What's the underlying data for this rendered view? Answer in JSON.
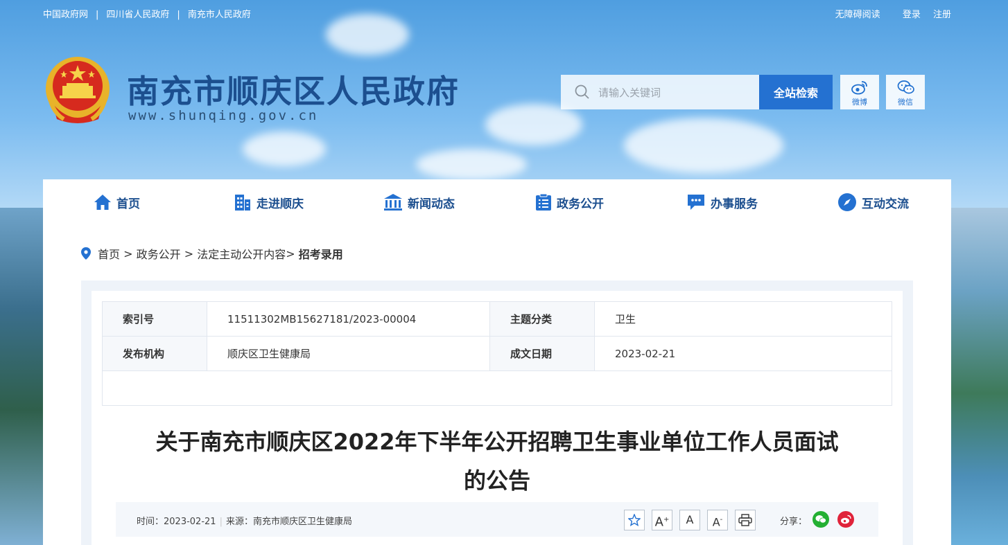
{
  "topbar": {
    "links": [
      "中国政府网",
      "四川省人民政府",
      "南充市人民政府"
    ],
    "separator": "|",
    "accessibility": "无障碍阅读",
    "login": "登录",
    "register": "注册"
  },
  "header": {
    "title": "南充市顺庆区人民政府",
    "url": "www.shunqing.gov.cn",
    "search_placeholder": "请输入关键词",
    "search_button": "全站检索",
    "weibo_label": "微博",
    "wechat_label": "微信"
  },
  "nav": {
    "items": [
      "首页",
      "走进顺庆",
      "新闻动态",
      "政务公开",
      "办事服务",
      "互动交流"
    ]
  },
  "breadcrumb": {
    "items": [
      "首页",
      "政务公开",
      "法定主动公开内容"
    ],
    "separator": " > ",
    "current_prefix": "> ",
    "current": "招考录用"
  },
  "meta": {
    "index_label": "索引号",
    "index_value": "11511302MB15627181/2023-00004",
    "topic_label": "主题分类",
    "topic_value": "卫生",
    "publisher_label": "发布机构",
    "publisher_value": "顺庆区卫生健康局",
    "date_label": "成文日期",
    "date_value": "2023-02-21"
  },
  "article": {
    "title_line1": "关于南充市顺庆区2022年下半年公开招聘卫生事业单位工作人员面试",
    "title_line2": "的公告",
    "time_label": "时间：",
    "time_value": "2023-02-21",
    "source_label": "来源：",
    "source_value": "南充市顺庆区卫生健康局",
    "share_label": "分享：",
    "font_large": "A",
    "font_normal": "A",
    "font_small": "A"
  },
  "colors": {
    "brand_blue": "#1c4f8f",
    "button_blue": "#2471d1",
    "wechat_green": "#24b033",
    "weibo_red": "#e0233a"
  }
}
